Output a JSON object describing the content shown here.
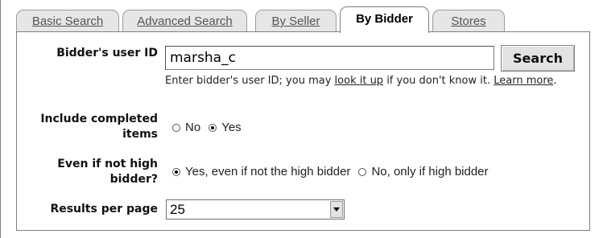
{
  "tabs": [
    {
      "label": "Basic Search",
      "active": false
    },
    {
      "label": "Advanced Search",
      "active": false
    },
    {
      "label": "By Seller",
      "active": false
    },
    {
      "label": "By Bidder",
      "active": true
    },
    {
      "label": "Stores",
      "active": false
    }
  ],
  "bidder": {
    "label": "Bidder's user ID",
    "value": "marsha_c",
    "search_label": "Search",
    "help_prefix": "Enter bidder's user ID; you may ",
    "help_link": "look it up",
    "help_middle": " if you don't know it. ",
    "help_link2": "Learn more",
    "help_suffix": "."
  },
  "completed": {
    "label_line1": "Include completed",
    "label_line2": "items",
    "options": [
      {
        "label": "No",
        "checked": false
      },
      {
        "label": "Yes",
        "checked": true
      }
    ]
  },
  "not_high": {
    "label_line1": "Even if not high",
    "label_line2": "bidder?",
    "options": [
      {
        "label": "Yes, even if not the high bidder",
        "checked": true
      },
      {
        "label": "No, only if high bidder",
        "checked": false
      }
    ]
  },
  "results": {
    "label": "Results per page",
    "value": "25"
  },
  "icons": {
    "dropdown": "chevron-down-icon"
  }
}
